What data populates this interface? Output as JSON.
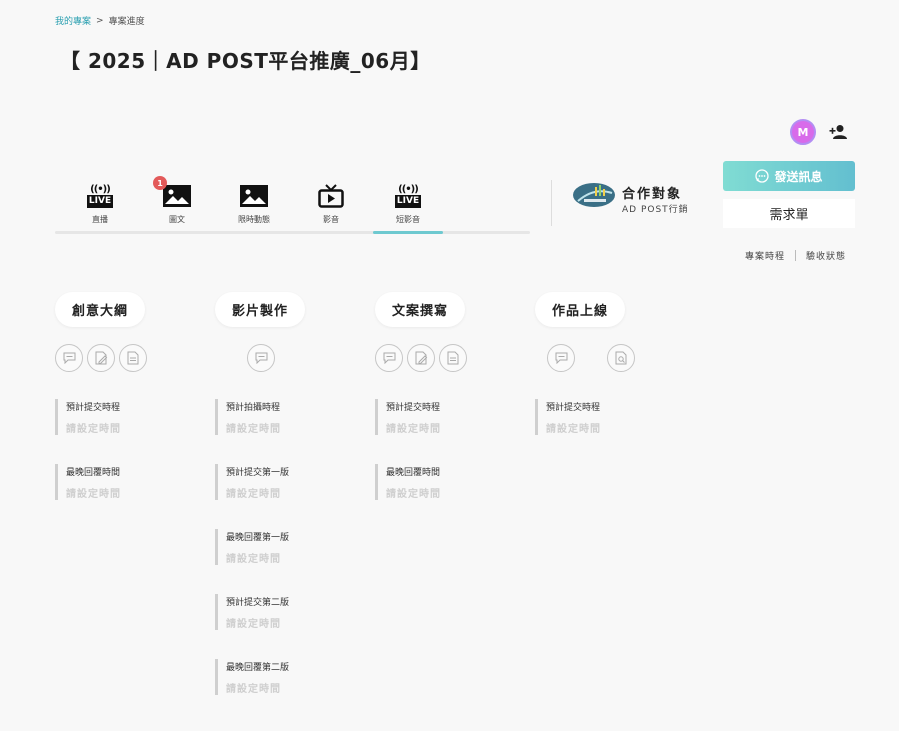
{
  "breadcrumb": {
    "root": "我的專案",
    "separator": ">",
    "current": "專案進度"
  },
  "title": "【 2025｜AD POST平台推廣_06月】",
  "avatar_initial": "M",
  "content_types": [
    {
      "label": "直播",
      "icon": "live-icon"
    },
    {
      "label": "圖文",
      "icon": "image-icon",
      "badge": "1"
    },
    {
      "label": "限時動態",
      "icon": "image-icon"
    },
    {
      "label": "影音",
      "icon": "tv-icon"
    },
    {
      "label": "短影音",
      "icon": "live-icon",
      "active": true
    }
  ],
  "partner": {
    "heading": "合作對象",
    "name": "AD POST行銷"
  },
  "buttons": {
    "send_message": "發送訊息",
    "requirements": "需求單"
  },
  "links": {
    "schedule": "專案時程",
    "acceptance": "驗收狀態"
  },
  "colors": {
    "accent": "#6ec9d0",
    "badge": "#e35a5a",
    "avatar": "#d86bea"
  },
  "stages": [
    {
      "title": "創意大綱",
      "icons": [
        "comment-icon",
        "edit-doc-icon",
        "doc-icon"
      ],
      "milestones": [
        {
          "label": "預計提交時程",
          "value": "請設定時間"
        },
        {
          "label": "最晚回覆時間",
          "value": "請設定時間"
        }
      ]
    },
    {
      "title": "影片製作",
      "icons": [
        "comment-icon"
      ],
      "milestones": [
        {
          "label": "預計拍攝時程",
          "value": "請設定時間"
        },
        {
          "label": "預計提交第一版",
          "value": "請設定時間"
        },
        {
          "label": "最晚回覆第一版",
          "value": "請設定時間"
        },
        {
          "label": "預計提交第二版",
          "value": "請設定時間"
        },
        {
          "label": "最晚回覆第二版",
          "value": "請設定時間"
        }
      ]
    },
    {
      "title": "文案撰寫",
      "icons": [
        "comment-icon",
        "edit-doc-icon",
        "doc-icon"
      ],
      "milestones": [
        {
          "label": "預計提交時程",
          "value": "請設定時間"
        },
        {
          "label": "最晚回覆時間",
          "value": "請設定時間"
        }
      ]
    },
    {
      "title": "作品上線",
      "icons": [
        "comment-icon",
        "search-doc-icon"
      ],
      "milestones": [
        {
          "label": "預計提交時程",
          "value": "請設定時間"
        }
      ]
    }
  ]
}
